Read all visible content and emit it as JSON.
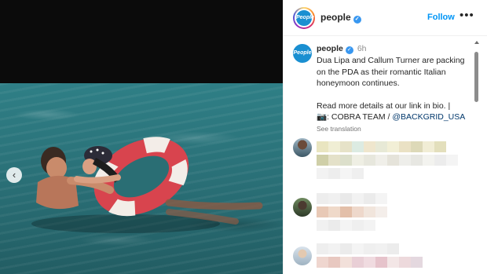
{
  "post": {
    "author": "people",
    "avatar_label": "People",
    "verified_glyph": "✓",
    "follow_label": "Follow",
    "more_label": "•••",
    "carousel_prev_label": "‹"
  },
  "caption": {
    "author": "people",
    "time": "6h",
    "lines": [
      "Dua Lipa and Callum Turner are packing",
      "on the PDA as their romantic Italian",
      "honeymoon continues."
    ],
    "read_more": "Read more details at our link in bio. |",
    "credit_prefix": "📷:  COBRA TEAM / ",
    "credit_mention": "@BACKGRID_USA",
    "see_translation": "See translation"
  },
  "icons": [
    "verified-badge-icon",
    "more-options-icon",
    "camera-icon",
    "chevron-left-icon"
  ],
  "colors": {
    "accent": "#0095f6",
    "verified": "#3897f0",
    "mention": "#00376b",
    "sea": "#2a7077",
    "float_red": "#d8444e",
    "float_white": "#f3ede8"
  }
}
